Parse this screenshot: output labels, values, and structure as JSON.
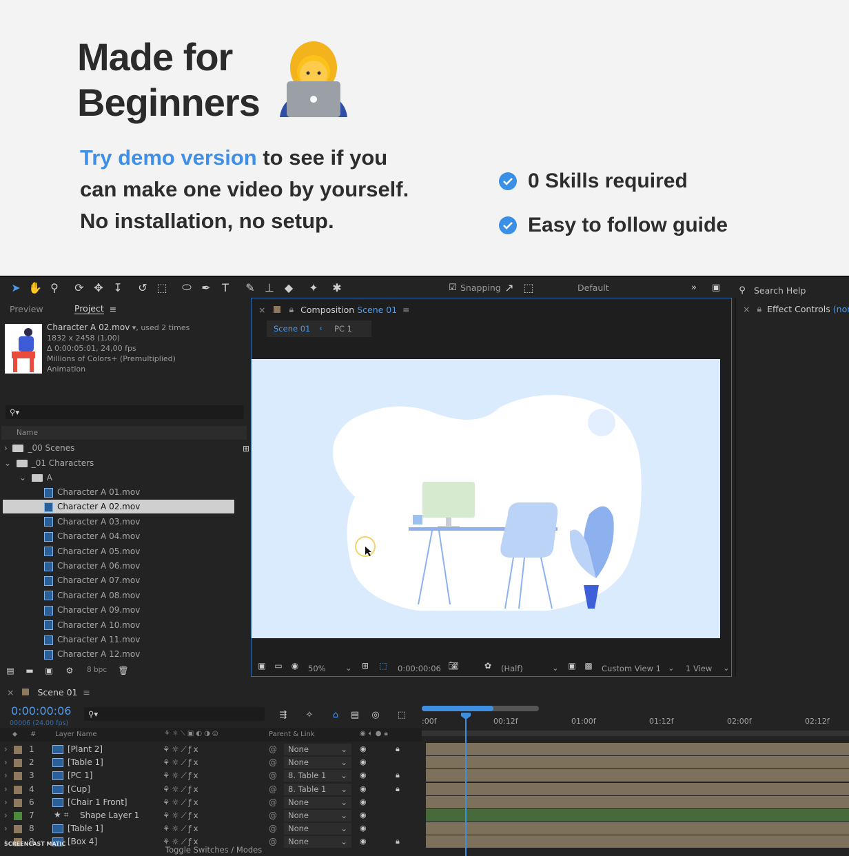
{
  "hero": {
    "title": "Made for Beginners",
    "link_text": "Try demo version",
    "line1_rest": " to see if you",
    "line2": "can make one video by yourself.",
    "line3": "No installation, no setup.",
    "checks": [
      "0 Skills required",
      "Easy to follow guide"
    ],
    "accent": "#3f8fe8"
  },
  "toolbar": {
    "snapping": "Snapping",
    "workspace": "Default",
    "search": "Search Help"
  },
  "project": {
    "tab_preview": "Preview",
    "tab_project": "Project",
    "file": "Character A 02.mov",
    "used": ", used 2 times",
    "info": [
      "1832 x 2458 (1,00)",
      "Δ 0:00:05:01, 24,00 fps",
      "Millions of Colors+ (Premultiplied)",
      "Animation"
    ],
    "column_name": "Name",
    "folders": [
      "_00 Scenes",
      "_01 Characters",
      "A"
    ],
    "items": [
      "Character A 01.mov",
      "Character A 02.mov",
      "Character A 03.mov",
      "Character A 04.mov",
      "Character A 05.mov",
      "Character A 06.mov",
      "Character A 07.mov",
      "Character A 08.mov",
      "Character A 09.mov",
      "Character A 10.mov",
      "Character A 11.mov",
      "Character A 12.mov"
    ],
    "bpc": "8 bpc"
  },
  "composition": {
    "label": "Composition",
    "name": "Scene 01",
    "tab_scene": "Scene 01",
    "tab_pc": "PC 1",
    "zoom": "50%",
    "timecode": "0:00:00:06",
    "resolution": "(Half)",
    "view": "Custom View 1",
    "views": "1 View"
  },
  "effects": {
    "label": "Effect Controls",
    "value": "(none"
  },
  "timeline": {
    "comp_tab": "Scene 01",
    "timecode": "0:00:00:06",
    "frames": "00006 (24.00 fps)",
    "col_layer": "Layer Name",
    "col_parent": "Parent & Link",
    "ticks": [
      ":00f",
      "00:12f",
      "01:00f",
      "01:12f",
      "02:00f",
      "02:12f"
    ],
    "layers": [
      {
        "num": "1",
        "name": "[Plant 2]",
        "parent": "None"
      },
      {
        "num": "2",
        "name": "[Table 1]",
        "parent": "None"
      },
      {
        "num": "3",
        "name": "[PC 1]",
        "parent": "8. Table 1"
      },
      {
        "num": "4",
        "name": "[Cup]",
        "parent": "8. Table 1"
      },
      {
        "num": "6",
        "name": "[Chair 1 Front]",
        "parent": "None"
      },
      {
        "num": "7",
        "name": "Shape Layer 1",
        "parent": "None"
      },
      {
        "num": "8",
        "name": "[Table 1]",
        "parent": "None"
      },
      {
        "num": "9",
        "name": "[Box 4]",
        "parent": "None"
      }
    ],
    "footer": "Toggle Switches / Modes"
  },
  "watermark": "SCREENCAST MATIC"
}
